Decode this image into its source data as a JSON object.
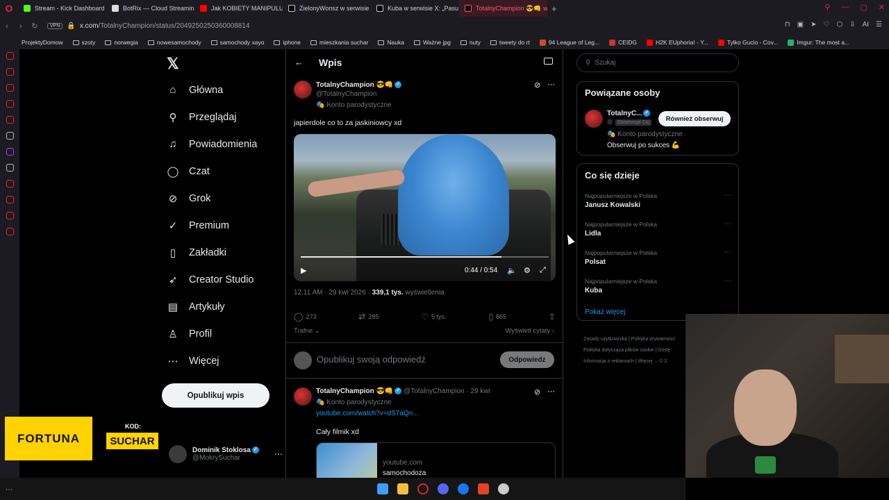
{
  "browser": {
    "tabs": [
      {
        "label": "Stream - Kick Dashboard",
        "color": "#53fc18"
      },
      {
        "label": "BotRix — Cloud Streaming",
        "color": "#ffffff"
      },
      {
        "label": "Jak KOBIETY MANIPULU...",
        "color": "#ff0000"
      },
      {
        "label": "ZielonyWonsz w serwisie",
        "color": "#ffffff"
      },
      {
        "label": "Kuba w serwisie X: „Pasu",
        "color": "#ffffff"
      },
      {
        "label": "TotalnyChampion 😎👊 w",
        "color": "#ffffff"
      }
    ],
    "url_domain": "x.com",
    "url_path": "/TotalnyChampion/status/2049250250360008814",
    "vpn": "VPN",
    "bookmarks": [
      "ProjektyDomow",
      "szoty",
      "norwegia",
      "nowesamochody",
      "samochody xayo",
      "iphone",
      "mieszkania suchar",
      "Nauka",
      "Ważne jpg",
      "nuty",
      "tweety do rt",
      "94 League of Leg...",
      "CEIDG",
      "H2K EUphoria! - Y...",
      "Tylko Gucio - Cov...",
      "Imgur: The most a..."
    ]
  },
  "nav": {
    "items": [
      {
        "label": "Główna",
        "icon": "home-icon",
        "glyph": "⌂"
      },
      {
        "label": "Przeglądaj",
        "icon": "search-icon",
        "glyph": "⚲"
      },
      {
        "label": "Powiadomienia",
        "icon": "bell-icon",
        "glyph": "♫"
      },
      {
        "label": "Czat",
        "icon": "chat-icon",
        "glyph": "◯"
      },
      {
        "label": "Grok",
        "icon": "grok-icon",
        "glyph": "⊘"
      },
      {
        "label": "Premium",
        "icon": "premium-icon",
        "glyph": "✓"
      },
      {
        "label": "Zakładki",
        "icon": "bookmark-icon",
        "glyph": "▯"
      },
      {
        "label": "Creator Studio",
        "icon": "rocket-icon",
        "glyph": "➶"
      },
      {
        "label": "Artykuły",
        "icon": "articles-icon",
        "glyph": "▤"
      },
      {
        "label": "Profil",
        "icon": "profile-icon",
        "glyph": "♙"
      },
      {
        "label": "Więcej",
        "icon": "more-icon",
        "glyph": "⋯"
      }
    ],
    "post_button": "Opublikuj wpis",
    "account_name": "Dominik Stoklosa",
    "account_handle": "@MokrySuchar"
  },
  "post": {
    "header_title": "Wpis",
    "author_name": "TotalnyChampion 😎👊",
    "author_handle": "@TotalnyChampion",
    "parody_label": "🎭 Konto parodystyczne",
    "text": "japierdole co to za jaskiniowcy xd",
    "video_time": "0:44 / 0:54",
    "video_progress": 0.81,
    "timestamp": "12:11 AM · 29 kwi 2026 ·",
    "views": "339,1 tys.",
    "views_label": "wyświetlenia",
    "replies": "273",
    "reposts": "285",
    "likes": "5 tys.",
    "bookmarks": "865",
    "sort": "Trafne",
    "quotes_link": "Wyświetl cytaty",
    "reply_placeholder": "Opublikuj swoją odpowiedź",
    "reply_button": "Odpowiedz"
  },
  "reply_tweet": {
    "author_name": "TotalnyChampion 😎👊",
    "author_handle": "@TotalnyChampion",
    "time": "· 29 kwi",
    "parody_label": "🎭 Konto parodystyczne",
    "link": "youtube.com/watch?v=dS7aQn...",
    "text": "Cały filmik xd",
    "card_domain": "youtube.com",
    "card_title": "samochodoza"
  },
  "right": {
    "search_placeholder": "Szukaj",
    "related_title": "Powiązane osoby",
    "related_name": "TotalnyC...",
    "related_tag": "Obserwuje Cię",
    "related_parody": "🎭 Konto parodystyczne",
    "related_bio": "Obserwuj po sukces 💪",
    "follow_back": "Również obserwuj",
    "trends_title": "Co się dzieje",
    "trends": [
      {
        "context": "Najpopularniejsze w Polska",
        "name": "Janusz Kowalski"
      },
      {
        "context": "Najpopularniejsze w Polska",
        "name": "Lidla"
      },
      {
        "context": "Najpopularniejsze w Polska",
        "name": "Polsat"
      },
      {
        "context": "Najpopularniejsze w Polska",
        "name": "Kuba"
      }
    ],
    "show_more": "Pokaż więcej",
    "footer": [
      "Zasady użytkownika",
      "Polityka prywatności",
      "Polityka dotycząca plików cookie",
      "Dostę",
      "Informacja o reklamach",
      "Więcej ...",
      "© 2"
    ]
  },
  "overlay": {
    "ad_brand": "FORTUNA",
    "ad_kod_label": "KOD:",
    "ad_code": "SUCHAR"
  }
}
